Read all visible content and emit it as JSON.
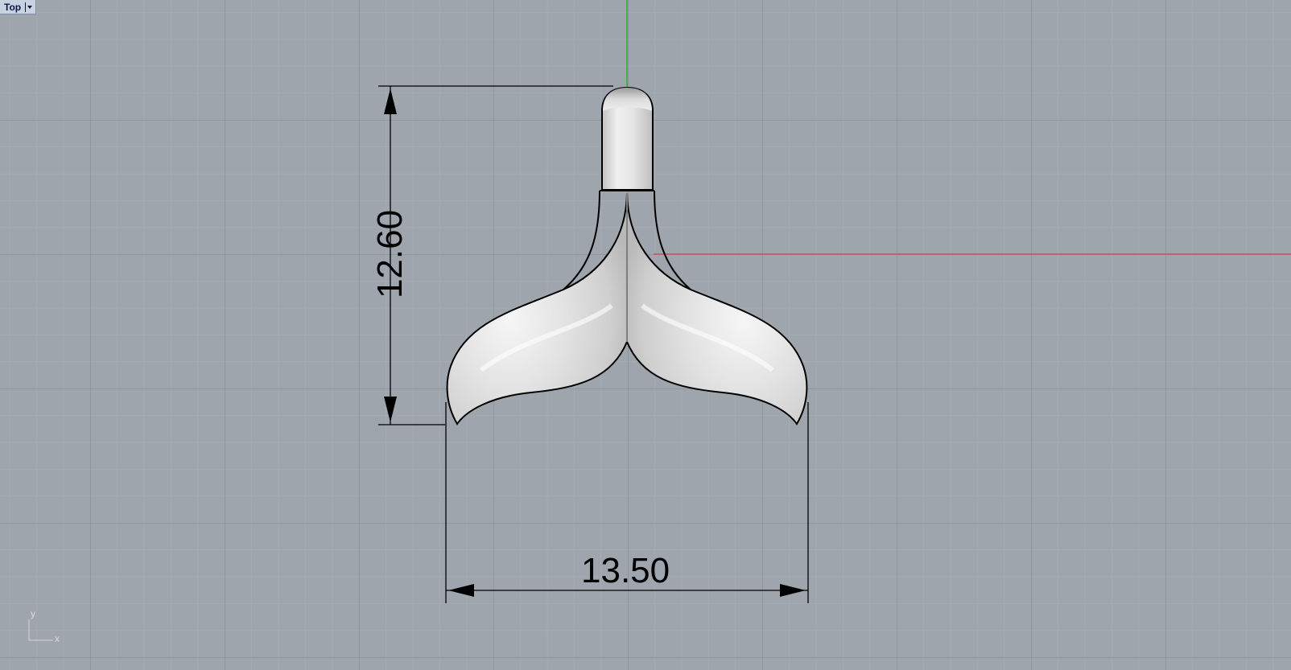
{
  "viewport": {
    "name": "Top",
    "background_color": "#9ea5ad",
    "grid_minor_color": "#a9afb6",
    "grid_major_color": "#8a9098",
    "x_axis_color": "#c8505a",
    "y_axis_color": "#3aa83a"
  },
  "dimensions": {
    "horizontal": "13.50",
    "vertical": "12.60"
  },
  "axes_icon": {
    "x_label": "x",
    "y_label": "y"
  }
}
